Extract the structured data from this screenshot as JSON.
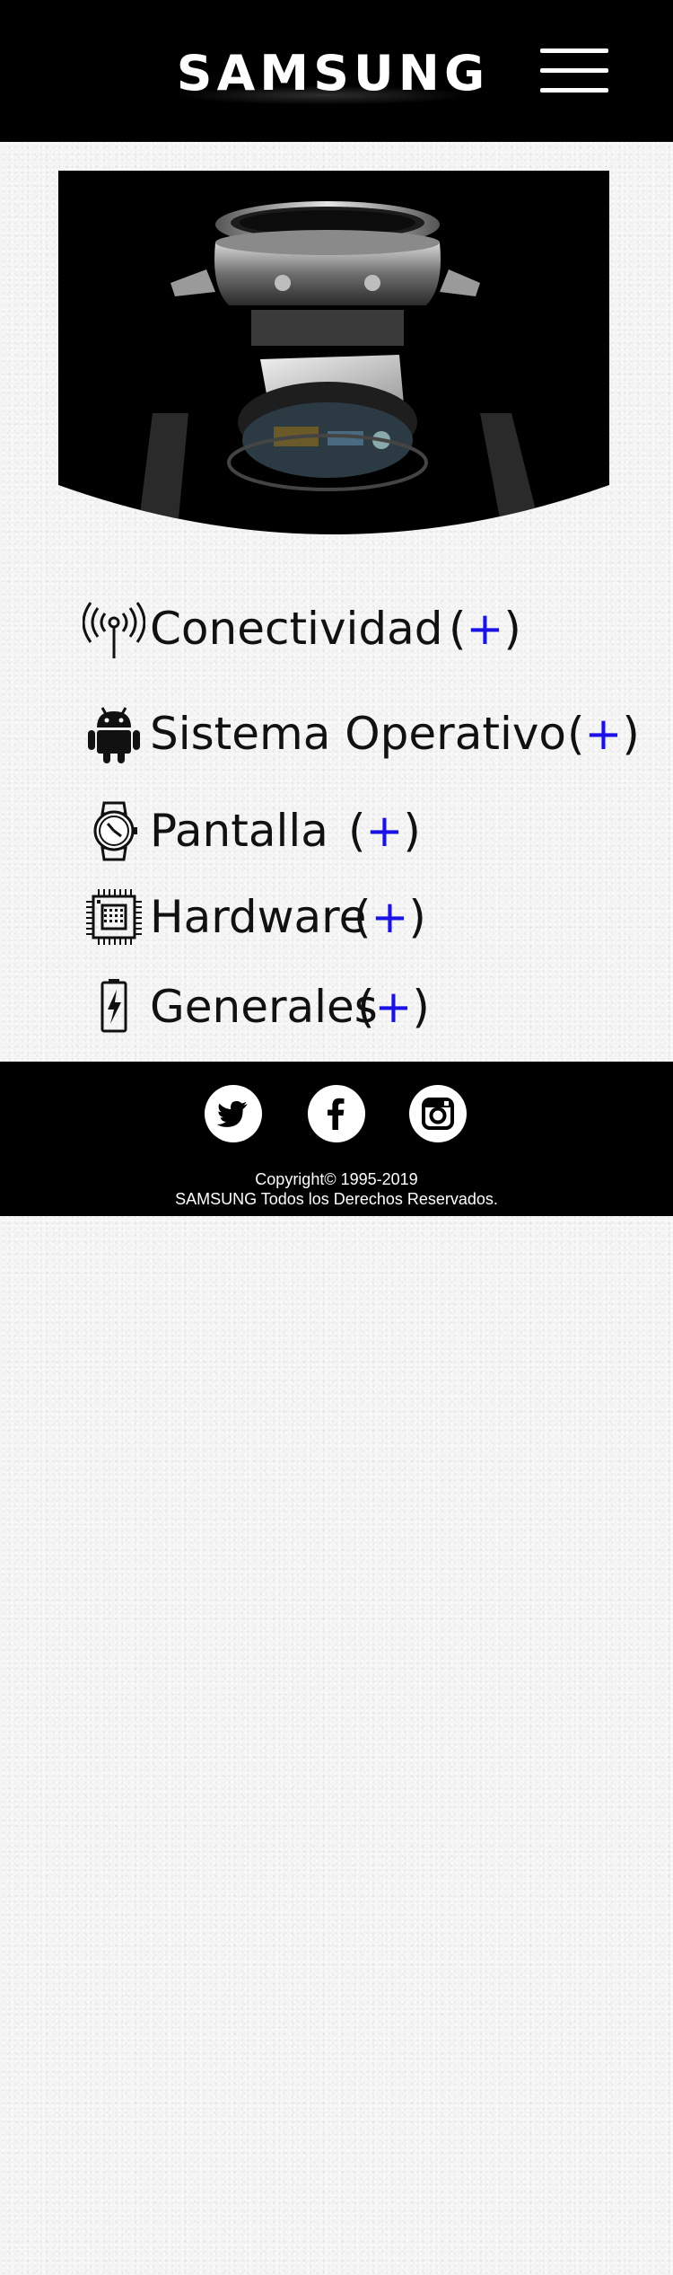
{
  "header": {
    "logo_text": "SAMSUNG",
    "menu_icon": "hamburger-menu-icon"
  },
  "hero": {
    "image": "smartwatch-exploded-view"
  },
  "specs": [
    {
      "label": "Conectividad",
      "toggle_open": "(",
      "toggle_plus": "+",
      "toggle_close": ")",
      "icon": "antenna-icon"
    },
    {
      "label": "Sistema Operativo",
      "toggle_open": "(",
      "toggle_plus": "+",
      "toggle_close": ")",
      "icon": "android-icon"
    },
    {
      "label": "Pantalla",
      "toggle_open": "(",
      "toggle_plus": "+",
      "toggle_close": ")",
      "icon": "watch-icon"
    },
    {
      "label": "Hardware",
      "toggle_open": "(",
      "toggle_plus": "+",
      "toggle_close": ")",
      "icon": "chip-icon"
    },
    {
      "label": "Generales",
      "toggle_open": "(",
      "toggle_plus": "+",
      "toggle_close": ")",
      "icon": "battery-icon"
    }
  ],
  "footer": {
    "social": [
      "twitter-icon",
      "facebook-icon",
      "instagram-icon"
    ],
    "copyright_line1": "Copyright© 1995-2019",
    "copyright_line2": "SAMSUNG Todos los Derechos Reservados."
  },
  "colors": {
    "header_bg": "#000000",
    "accent_plus": "#1a12e6",
    "page_bg": "#f4f4f4"
  }
}
